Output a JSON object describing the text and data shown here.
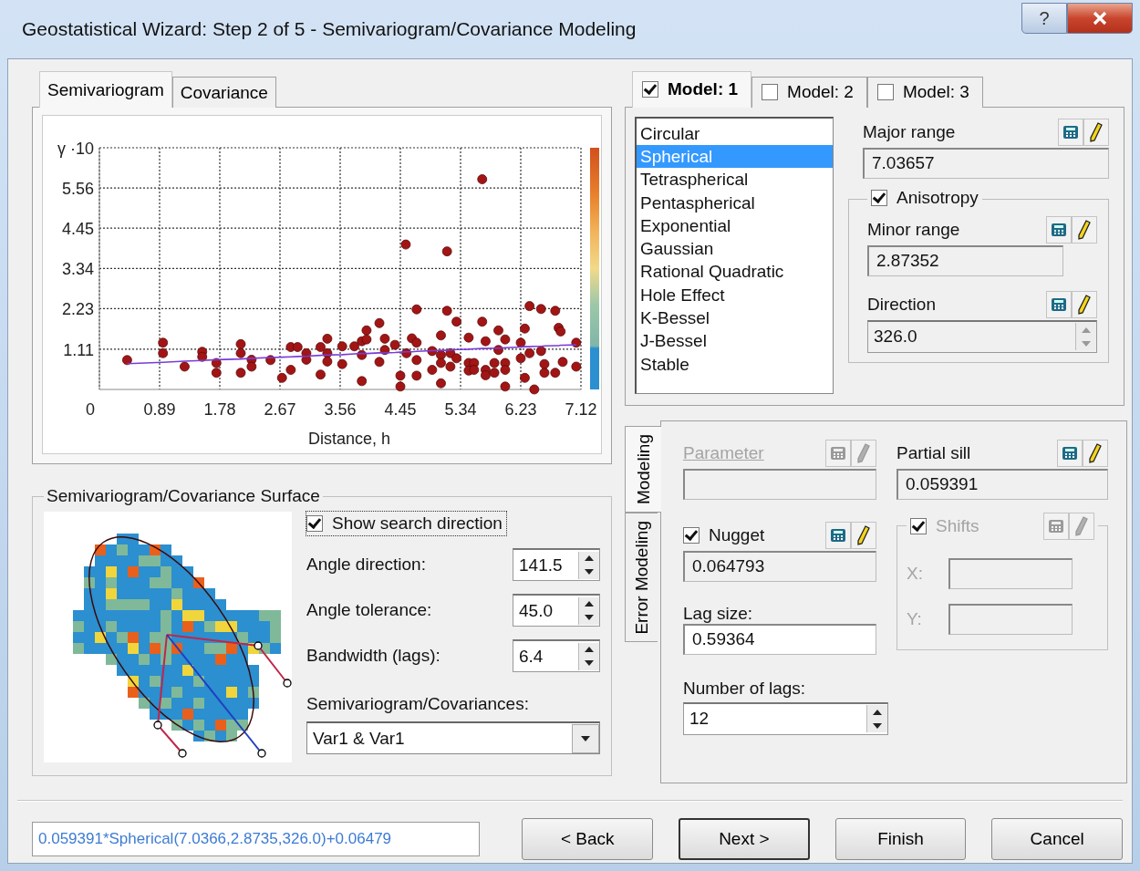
{
  "window": {
    "title": "Geostatistical Wizard: Step 2 of 5 - Semivariogram/Covariance Modeling",
    "help_button": "?"
  },
  "plot_tabs": [
    {
      "label": "Semivariogram",
      "selected": true
    },
    {
      "label": "Covariance",
      "selected": false
    }
  ],
  "plot": {
    "chart_data": {
      "type": "scatter",
      "ylabel": "γ ·10",
      "xlabel": "Distance, h",
      "xlim": [
        0,
        7.12
      ],
      "ylim": [
        0,
        6.67
      ],
      "xticks": [
        0,
        0.89,
        1.78,
        2.67,
        3.56,
        4.45,
        5.34,
        6.23,
        7.12
      ],
      "yticks": [
        1.11,
        2.23,
        3.34,
        4.45,
        5.56
      ],
      "grid": true,
      "x": [
        0.41,
        0.94,
        0.94,
        1.26,
        1.52,
        1.52,
        1.73,
        1.73,
        2.09,
        2.09,
        2.09,
        2.25,
        2.25,
        2.53,
        2.7,
        2.83,
        2.83,
        2.93,
        3.06,
        3.06,
        3.27,
        3.27,
        3.37,
        3.37,
        3.37,
        3.59,
        3.59,
        3.77,
        3.88,
        3.88,
        3.88,
        3.95,
        3.95,
        4.14,
        4.14,
        4.22,
        4.22,
        4.37,
        4.45,
        4.45,
        4.53,
        4.54,
        4.62,
        4.69,
        4.69,
        4.69,
        4.69,
        4.92,
        4.92,
        5.05,
        5.05,
        5.05,
        5.05,
        5.14,
        5.14,
        5.19,
        5.19,
        5.28,
        5.28,
        5.46,
        5.46,
        5.46,
        5.54,
        5.54,
        5.66,
        5.66,
        5.71,
        5.71,
        5.71,
        5.84,
        5.84,
        5.9,
        5.9,
        6.0,
        6.0,
        6.0,
        6.0,
        6.23,
        6.23,
        6.29,
        6.29,
        6.36,
        6.36,
        6.43,
        6.53,
        6.53,
        6.58,
        6.58,
        6.74,
        6.74,
        6.79,
        6.82,
        6.85,
        7.05,
        7.05
      ],
      "series": [
        {
          "color": "#a31515",
          "values": [
            0.81,
            1.29,
            1.0,
            0.63,
            1.04,
            0.9,
            0.73,
            0.46,
            1.25,
            1.0,
            0.46,
            0.82,
            0.63,
            0.81,
            0.32,
            0.54,
            1.17,
            1.17,
            1.0,
            0.82,
            0.41,
            1.17,
            1.4,
            1.0,
            0.77,
            1.19,
            0.7,
            1.19,
            1.33,
            0.95,
            0.23,
            1.63,
            1.38,
            1.83,
            0.76,
            1.4,
            1.09,
            1.23,
            0.38,
            0.08,
            4.0,
            1.0,
            1.41,
            2.21,
            1.29,
            0.81,
            0.38,
            1.06,
            0.54,
            1.49,
            0.95,
            0.73,
            0.17,
            3.81,
            2.17,
            1.0,
            0.63,
            1.87,
            0.86,
            1.43,
            0.73,
            0.52,
            0.73,
            0.54,
            5.8,
            1.87,
            1.33,
            0.54,
            0.39,
            0.73,
            0.46,
            1.63,
            1.09,
            1.38,
            0.73,
            0.54,
            0.08,
            1.29,
            0.86,
            1.68,
            0.32,
            2.3,
            1.0,
            0.0,
            2.22,
            1.06,
            0.7,
            0.46,
            2.17,
            0.46,
            1.7,
            1.6,
            0.76,
            1.29,
            0.63
          ]
        },
        {
          "color": "#7a3bd6",
          "type": "line",
          "values": [
            0.71,
            0.75,
            0.75,
            0.78,
            0.8,
            0.8,
            0.82,
            0.82,
            0.84,
            0.84,
            0.84,
            0.86,
            0.86,
            0.88,
            0.89,
            0.9,
            0.9,
            0.91,
            0.92,
            0.92,
            0.94,
            0.94,
            0.95,
            0.95,
            0.95,
            0.96,
            0.96,
            0.98,
            0.99,
            0.99,
            0.99,
            0.99,
            0.99,
            1.01,
            1.01,
            1.01,
            1.01,
            1.02,
            1.03,
            1.03,
            1.04,
            1.04,
            1.04,
            1.05,
            1.05,
            1.05,
            1.05,
            1.07,
            1.07,
            1.08,
            1.08,
            1.08,
            1.08,
            1.08,
            1.08,
            1.09,
            1.09,
            1.1,
            1.1,
            1.11,
            1.11,
            1.11,
            1.12,
            1.12,
            1.13,
            1.13,
            1.13,
            1.13,
            1.13,
            1.14,
            1.14,
            1.14,
            1.14,
            1.15,
            1.15,
            1.15,
            1.15,
            1.17,
            1.17,
            1.18,
            1.18,
            1.18,
            1.18,
            1.19,
            1.19,
            1.19,
            1.2,
            1.2,
            1.21,
            1.21,
            1.21,
            1.22,
            1.22,
            1.23,
            1.23
          ]
        }
      ]
    }
  },
  "surface": {
    "title": "Semivariogram/Covariance Surface",
    "show_search_direction": {
      "label": "Show search direction",
      "checked": true
    },
    "spinners": [
      {
        "label": "Angle direction:",
        "value": "141.5"
      },
      {
        "label": "Angle tolerance:",
        "value": "45.0"
      },
      {
        "label": "Bandwidth (lags):",
        "value": "6.4"
      }
    ],
    "dataset": {
      "label": "Semivariogram/Covariances:",
      "value": "Var1 & Var1"
    }
  },
  "model_tabs": [
    {
      "label": "Model:  1",
      "checked": true,
      "selected": true
    },
    {
      "label": "Model:  2",
      "checked": false,
      "selected": false
    },
    {
      "label": "Model:  3",
      "checked": false,
      "selected": false
    }
  ],
  "model_types": [
    {
      "name": "Circular",
      "selected": false
    },
    {
      "name": "Spherical",
      "selected": true
    },
    {
      "name": "Tetraspherical",
      "selected": false
    },
    {
      "name": "Pentaspherical",
      "selected": false
    },
    {
      "name": "Exponential",
      "selected": false
    },
    {
      "name": "Gaussian",
      "selected": false
    },
    {
      "name": "Rational Quadratic",
      "selected": false
    },
    {
      "name": "Hole Effect",
      "selected": false
    },
    {
      "name": "K-Bessel",
      "selected": false
    },
    {
      "name": "J-Bessel",
      "selected": false
    },
    {
      "name": "Stable",
      "selected": false
    }
  ],
  "major_range": {
    "label": "Major range",
    "value": "7.03657"
  },
  "anisotropy": {
    "label": "Anisotropy",
    "checked": true
  },
  "minor_range": {
    "label": "Minor range",
    "value": "2.87352"
  },
  "direction": {
    "label": "Direction",
    "value": "326.0"
  },
  "side_tabs": [
    {
      "label": "Modeling",
      "selected": true
    },
    {
      "label": "Error Modeling",
      "selected": false
    }
  ],
  "parameter": {
    "label": "Parameter",
    "disabled": true
  },
  "partial_sill": {
    "label": "Partial sill",
    "value": "0.059391"
  },
  "nugget": {
    "label": "Nugget",
    "checked": true,
    "value": "0.064793"
  },
  "shifts": {
    "label": "Shifts",
    "checked": true,
    "disabled": true,
    "x_label": "X:",
    "y_label": "Y:"
  },
  "lag_size": {
    "label": "Lag size:",
    "value": "0.59364"
  },
  "number_of_lags": {
    "label": "Number of lags:",
    "value": "12"
  },
  "formula": "0.059391*Spherical(7.0366,2.8735,326.0)+0.06479",
  "buttons": [
    {
      "label": "< Back",
      "default": false
    },
    {
      "label": "Next >",
      "default": true
    },
    {
      "label": "Finish",
      "default": false
    },
    {
      "label": "Cancel",
      "default": false
    }
  ]
}
